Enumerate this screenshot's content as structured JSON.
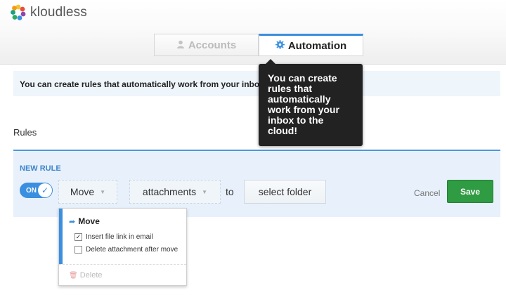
{
  "app": {
    "name": "kloudless"
  },
  "tabs": [
    {
      "label": "Accounts",
      "icon": "user-icon",
      "active": false
    },
    {
      "label": "Automation",
      "icon": "gear-icon",
      "active": true
    }
  ],
  "info_bar": {
    "text": "You can create rules that automatically work from your inbox"
  },
  "tooltip": {
    "text": "You can create rules that automatically work from your inbox to the cloud!"
  },
  "rules": {
    "title": "Rules",
    "new_rule_label": "NEW RULE",
    "toggle_label": "ON",
    "action_label": "Move",
    "target_label": "attachments",
    "to_label": "to",
    "select_folder_label": "select folder",
    "cancel_label": "Cancel",
    "save_label": "Save"
  },
  "menu": {
    "heading": "Move",
    "options": [
      {
        "label": "Insert file link in email",
        "checked": true
      },
      {
        "label": "Delete attachment after move",
        "checked": false
      }
    ],
    "delete_label": "Delete"
  },
  "colors": {
    "accent": "#3a8fe0",
    "save_green": "#2f9b42",
    "tooltip_bg": "#222222",
    "info_bg": "#eef5fb"
  }
}
